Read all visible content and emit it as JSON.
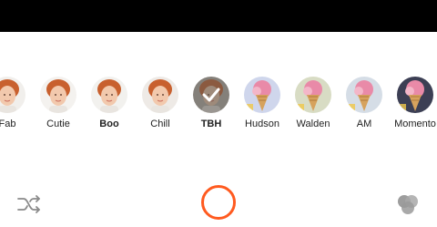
{
  "filters": [
    {
      "label": "Fab",
      "bold": false,
      "selected": false,
      "type": "face",
      "tint": "#f1efec"
    },
    {
      "label": "Cutie",
      "bold": false,
      "selected": false,
      "type": "face",
      "tint": "#f4f2ef"
    },
    {
      "label": "Boo",
      "bold": true,
      "selected": false,
      "type": "face",
      "tint": "#f2f1ee"
    },
    {
      "label": "Chill",
      "bold": false,
      "selected": false,
      "type": "face",
      "tint": "#eeeae6"
    },
    {
      "label": "TBH",
      "bold": true,
      "selected": true,
      "type": "face",
      "tint": "#b9b3ad"
    },
    {
      "label": "Hudson",
      "bold": false,
      "selected": false,
      "type": "icecream",
      "tint": "#cfd6ec"
    },
    {
      "label": "Walden",
      "bold": false,
      "selected": false,
      "type": "icecream",
      "tint": "#d8dcc4"
    },
    {
      "label": "AM",
      "bold": false,
      "selected": false,
      "type": "icecream",
      "tint": "#d5dde6"
    },
    {
      "label": "Momento",
      "bold": false,
      "selected": false,
      "type": "icecream",
      "tint": "#3c3f54"
    }
  ],
  "controls": {
    "shutter_color": "#ff5a1f",
    "shuffle_icon": "shuffle-icon",
    "color_icon": "color-circles-icon"
  }
}
